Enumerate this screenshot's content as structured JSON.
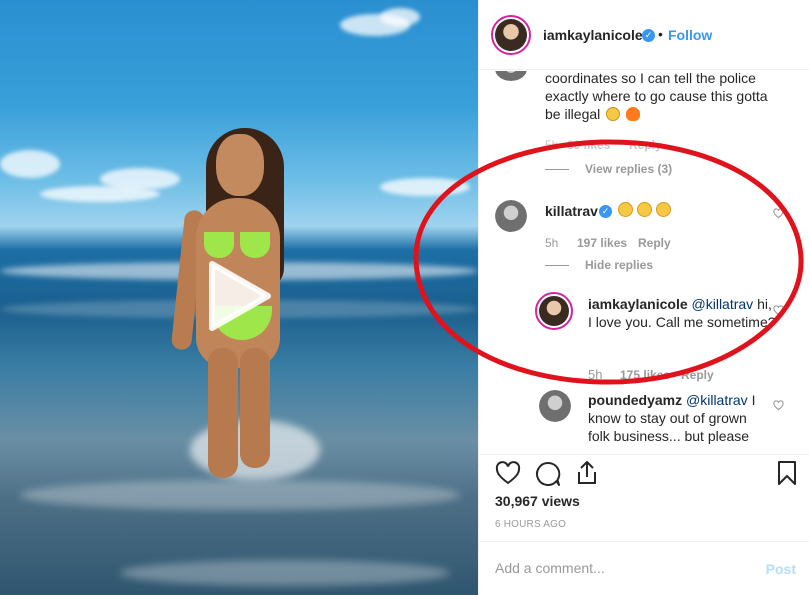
{
  "post": {
    "author": "iamkaylanicole",
    "follow_label": "Follow",
    "separator": "•"
  },
  "comments": [
    {
      "text": "coordinates so I can tell the police exactly where to go cause this gotta be illegal",
      "time": "5h",
      "likes": "30 likes",
      "reply_label": "Reply",
      "view_replies": "View replies (3)"
    },
    {
      "user": "killatrav",
      "verified": true,
      "emojis": [
        "smile-emoji",
        "smile-emoji",
        "smile-emoji"
      ],
      "time": "5h",
      "likes": "197 likes",
      "reply_label": "Reply",
      "hide_replies": "Hide replies",
      "replies": [
        {
          "user": "iamkaylanicole",
          "mention": "@killatrav",
          "text": "hi, I love you. Call me sometime?",
          "time": "5h",
          "likes": "175 likes",
          "reply_label": "Reply"
        },
        {
          "user": "poundedyamz",
          "mention": "@killatrav",
          "text_line1": "I",
          "text_rest": "know to stay out of grown folk business... but please"
        }
      ]
    }
  ],
  "stats": {
    "views": "30,967 views",
    "time_ago": "6 HOURS AGO"
  },
  "add_comment": {
    "placeholder": "Add a comment...",
    "post_label": "Post"
  },
  "colors": {
    "link_blue": "#3897f0",
    "annotation_red": "#e0121b",
    "bikini_green": "#9ee64a"
  }
}
